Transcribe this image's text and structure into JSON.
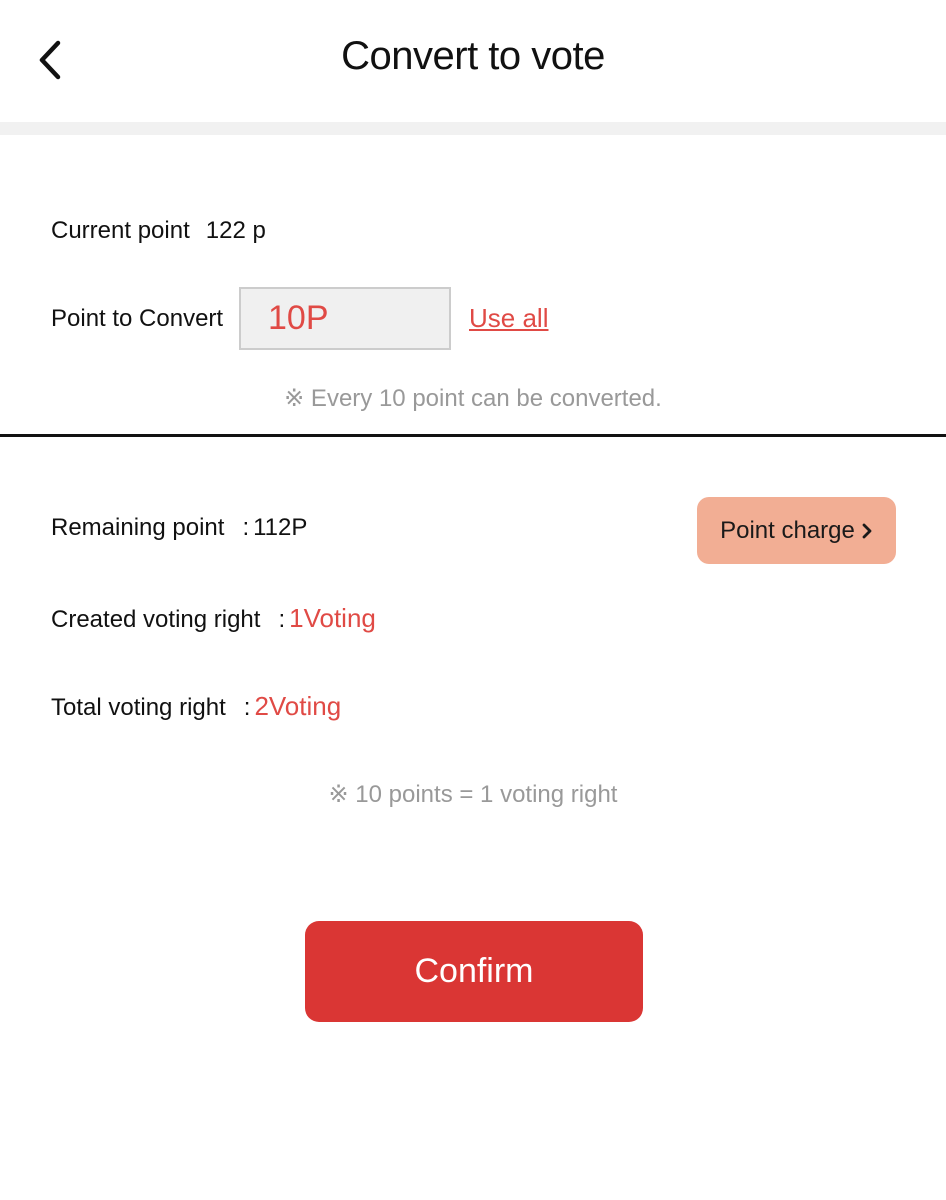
{
  "header": {
    "title": "Convert to vote",
    "back_icon": "chevron-left-icon"
  },
  "conversion": {
    "current_point_label": "Current point",
    "current_point_value": "122 p",
    "point_to_convert_label": "Point to Convert",
    "point_to_convert_value": "10P",
    "use_all_label": "Use all",
    "note": "※ Every 10 point can be converted."
  },
  "summary": {
    "remaining_label": "Remaining point",
    "remaining_value": "112P",
    "created_label": "Created voting right",
    "created_value": "1Voting",
    "total_label": "Total voting right",
    "total_value": "2Voting",
    "colon": ":",
    "point_charge_label": "Point charge",
    "point_charge_icon": "chevron-right-icon",
    "note": "※ 10 points = 1 voting right"
  },
  "actions": {
    "confirm_label": "Confirm"
  },
  "colors": {
    "accent_red": "#e04a45",
    "confirm_bg": "#da3634",
    "charge_bg": "#f2ae94",
    "note_gray": "#999999"
  }
}
